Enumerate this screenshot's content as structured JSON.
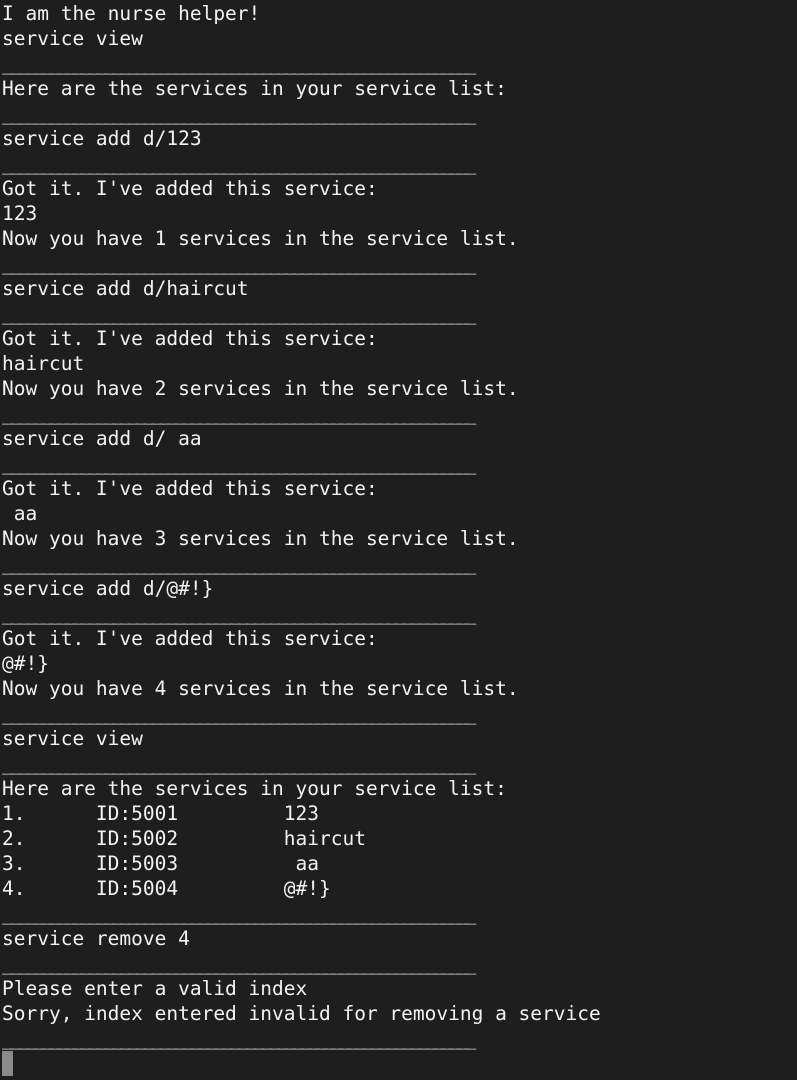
{
  "terminal": {
    "lines": [
      {
        "kind": "text",
        "text": "I am the nurse helper!"
      },
      {
        "kind": "text",
        "text": "service view"
      },
      {
        "kind": "sep"
      },
      {
        "kind": "text",
        "text": "Here are the services in your service list:"
      },
      {
        "kind": "sep"
      },
      {
        "kind": "text",
        "text": "service add d/123"
      },
      {
        "kind": "sep"
      },
      {
        "kind": "text",
        "text": "Got it. I've added this service:"
      },
      {
        "kind": "text",
        "text": "123"
      },
      {
        "kind": "text",
        "text": "Now you have 1 services in the service list."
      },
      {
        "kind": "sep"
      },
      {
        "kind": "text",
        "text": "service add d/haircut"
      },
      {
        "kind": "sep"
      },
      {
        "kind": "text",
        "text": "Got it. I've added this service:"
      },
      {
        "kind": "text",
        "text": "haircut"
      },
      {
        "kind": "text",
        "text": "Now you have 2 services in the service list."
      },
      {
        "kind": "sep"
      },
      {
        "kind": "text",
        "text": "service add d/ aa"
      },
      {
        "kind": "sep"
      },
      {
        "kind": "text",
        "text": "Got it. I've added this service:"
      },
      {
        "kind": "text",
        "text": " aa"
      },
      {
        "kind": "text",
        "text": "Now you have 3 services in the service list."
      },
      {
        "kind": "sep"
      },
      {
        "kind": "text",
        "text": "service add d/@#!}"
      },
      {
        "kind": "sep"
      },
      {
        "kind": "text",
        "text": "Got it. I've added this service:"
      },
      {
        "kind": "text",
        "text": "@#!}"
      },
      {
        "kind": "text",
        "text": "Now you have 4 services in the service list."
      },
      {
        "kind": "sep"
      },
      {
        "kind": "text",
        "text": "service view"
      },
      {
        "kind": "sep"
      },
      {
        "kind": "text",
        "text": "Here are the services in your service list:"
      },
      {
        "kind": "text",
        "text": "1.      ID:5001         123"
      },
      {
        "kind": "text",
        "text": "2.      ID:5002         haircut"
      },
      {
        "kind": "text",
        "text": "3.      ID:5003          aa"
      },
      {
        "kind": "text",
        "text": "4.      ID:5004         @#!}"
      },
      {
        "kind": "sep"
      },
      {
        "kind": "text",
        "text": "service remove 4"
      },
      {
        "kind": "sep"
      },
      {
        "kind": "text",
        "text": "Please enter a valid index"
      },
      {
        "kind": "text",
        "text": "Sorry, index entered invalid for removing a service"
      },
      {
        "kind": "sep"
      },
      {
        "kind": "prompt",
        "text": ""
      }
    ]
  }
}
